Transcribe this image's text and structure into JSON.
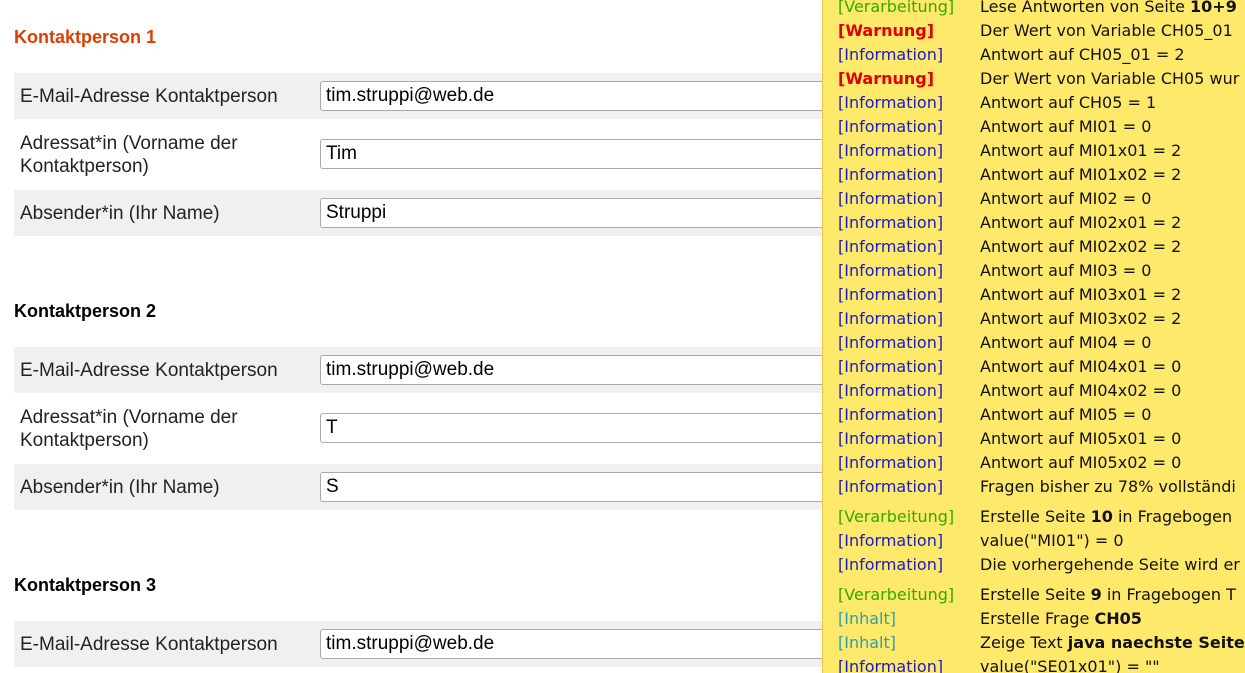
{
  "contacts": [
    {
      "title": "Kontaktperson 1",
      "fields": [
        {
          "label": "E-Mail-Adresse Kontaktperson",
          "value": "tim.struppi@web.de"
        },
        {
          "label_line1": "Adressat*in (Vorname der",
          "label_line2": "Kontaktperson)",
          "value": "Tim"
        },
        {
          "label": "Absender*in (Ihr Name)",
          "value": "Struppi"
        }
      ]
    },
    {
      "title": "Kontaktperson 2",
      "fields": [
        {
          "label": "E-Mail-Adresse Kontaktperson",
          "value": "tim.struppi@web.de"
        },
        {
          "label_line1": "Adressat*in (Vorname der",
          "label_line2": "Kontaktperson)",
          "value": "T"
        },
        {
          "label": "Absender*in (Ihr Name)",
          "value": "S"
        }
      ]
    },
    {
      "title": "Kontaktperson 3",
      "fields": [
        {
          "label": "E-Mail-Adresse Kontaktperson",
          "value": "tim.struppi@web.de"
        }
      ]
    }
  ],
  "debug_log": [
    {
      "tag": "[Verarbeitung]",
      "type": "proc",
      "pre": "Lese Antworten von Seite ",
      "bold": "10+9",
      "post": ""
    },
    {
      "tag": "[Warnung]",
      "type": "warn",
      "pre": "Der Wert von Variable CH05_01",
      "bold": "",
      "post": ""
    },
    {
      "tag": "[Information]",
      "type": "info",
      "pre": "Antwort auf CH05_01 = 2",
      "bold": "",
      "post": ""
    },
    {
      "tag": "[Warnung]",
      "type": "warn",
      "pre": "Der Wert von Variable CH05 wur",
      "bold": "",
      "post": ""
    },
    {
      "tag": "[Information]",
      "type": "info",
      "pre": "Antwort auf CH05 = 1",
      "bold": "",
      "post": ""
    },
    {
      "tag": "[Information]",
      "type": "info",
      "pre": "Antwort auf MI01 = 0",
      "bold": "",
      "post": ""
    },
    {
      "tag": "[Information]",
      "type": "info",
      "pre": "Antwort auf MI01x01 = 2",
      "bold": "",
      "post": ""
    },
    {
      "tag": "[Information]",
      "type": "info",
      "pre": "Antwort auf MI01x02 = 2",
      "bold": "",
      "post": ""
    },
    {
      "tag": "[Information]",
      "type": "info",
      "pre": "Antwort auf MI02 = 0",
      "bold": "",
      "post": ""
    },
    {
      "tag": "[Information]",
      "type": "info",
      "pre": "Antwort auf MI02x01 = 2",
      "bold": "",
      "post": ""
    },
    {
      "tag": "[Information]",
      "type": "info",
      "pre": "Antwort auf MI02x02 = 2",
      "bold": "",
      "post": ""
    },
    {
      "tag": "[Information]",
      "type": "info",
      "pre": "Antwort auf MI03 = 0",
      "bold": "",
      "post": ""
    },
    {
      "tag": "[Information]",
      "type": "info",
      "pre": "Antwort auf MI03x01 = 2",
      "bold": "",
      "post": ""
    },
    {
      "tag": "[Information]",
      "type": "info",
      "pre": "Antwort auf MI03x02 = 2",
      "bold": "",
      "post": ""
    },
    {
      "tag": "[Information]",
      "type": "info",
      "pre": "Antwort auf MI04 = 0",
      "bold": "",
      "post": ""
    },
    {
      "tag": "[Information]",
      "type": "info",
      "pre": "Antwort auf MI04x01 = 0",
      "bold": "",
      "post": ""
    },
    {
      "tag": "[Information]",
      "type": "info",
      "pre": "Antwort auf MI04x02 = 0",
      "bold": "",
      "post": ""
    },
    {
      "tag": "[Information]",
      "type": "info",
      "pre": "Antwort auf MI05 = 0",
      "bold": "",
      "post": ""
    },
    {
      "tag": "[Information]",
      "type": "info",
      "pre": "Antwort auf MI05x01 = 0",
      "bold": "",
      "post": ""
    },
    {
      "tag": "[Information]",
      "type": "info",
      "pre": "Antwort auf MI05x02 = 0",
      "bold": "",
      "post": ""
    },
    {
      "tag": "[Information]",
      "type": "info",
      "pre": "Fragen bisher zu 78% vollständi",
      "bold": "",
      "post": ""
    },
    {
      "tag": "[Verarbeitung]",
      "type": "proc",
      "pre": "Erstelle Seite ",
      "bold": "10",
      "post": " in Fragebogen"
    },
    {
      "tag": "[Information]",
      "type": "info",
      "pre": "value(\"MI01\") = 0",
      "bold": "",
      "post": ""
    },
    {
      "tag": "[Information]",
      "type": "info",
      "pre": "Die vorhergehende Seite wird er",
      "bold": "",
      "post": ""
    },
    {
      "tag": "[Verarbeitung]",
      "type": "proc",
      "pre": "Erstelle Seite ",
      "bold": "9",
      "post": " in Fragebogen T"
    },
    {
      "tag": "[Inhalt]",
      "type": "content",
      "pre": "Erstelle Frage ",
      "bold": "CH05",
      "post": ""
    },
    {
      "tag": "[Inhalt]",
      "type": "content",
      "pre": "Zeige Text ",
      "bold": "java naechste Seite",
      "post": ""
    },
    {
      "tag": "[Information]",
      "type": "info",
      "pre": "value(\"SE01x01\") = \"\"",
      "bold": "",
      "post": ""
    }
  ]
}
